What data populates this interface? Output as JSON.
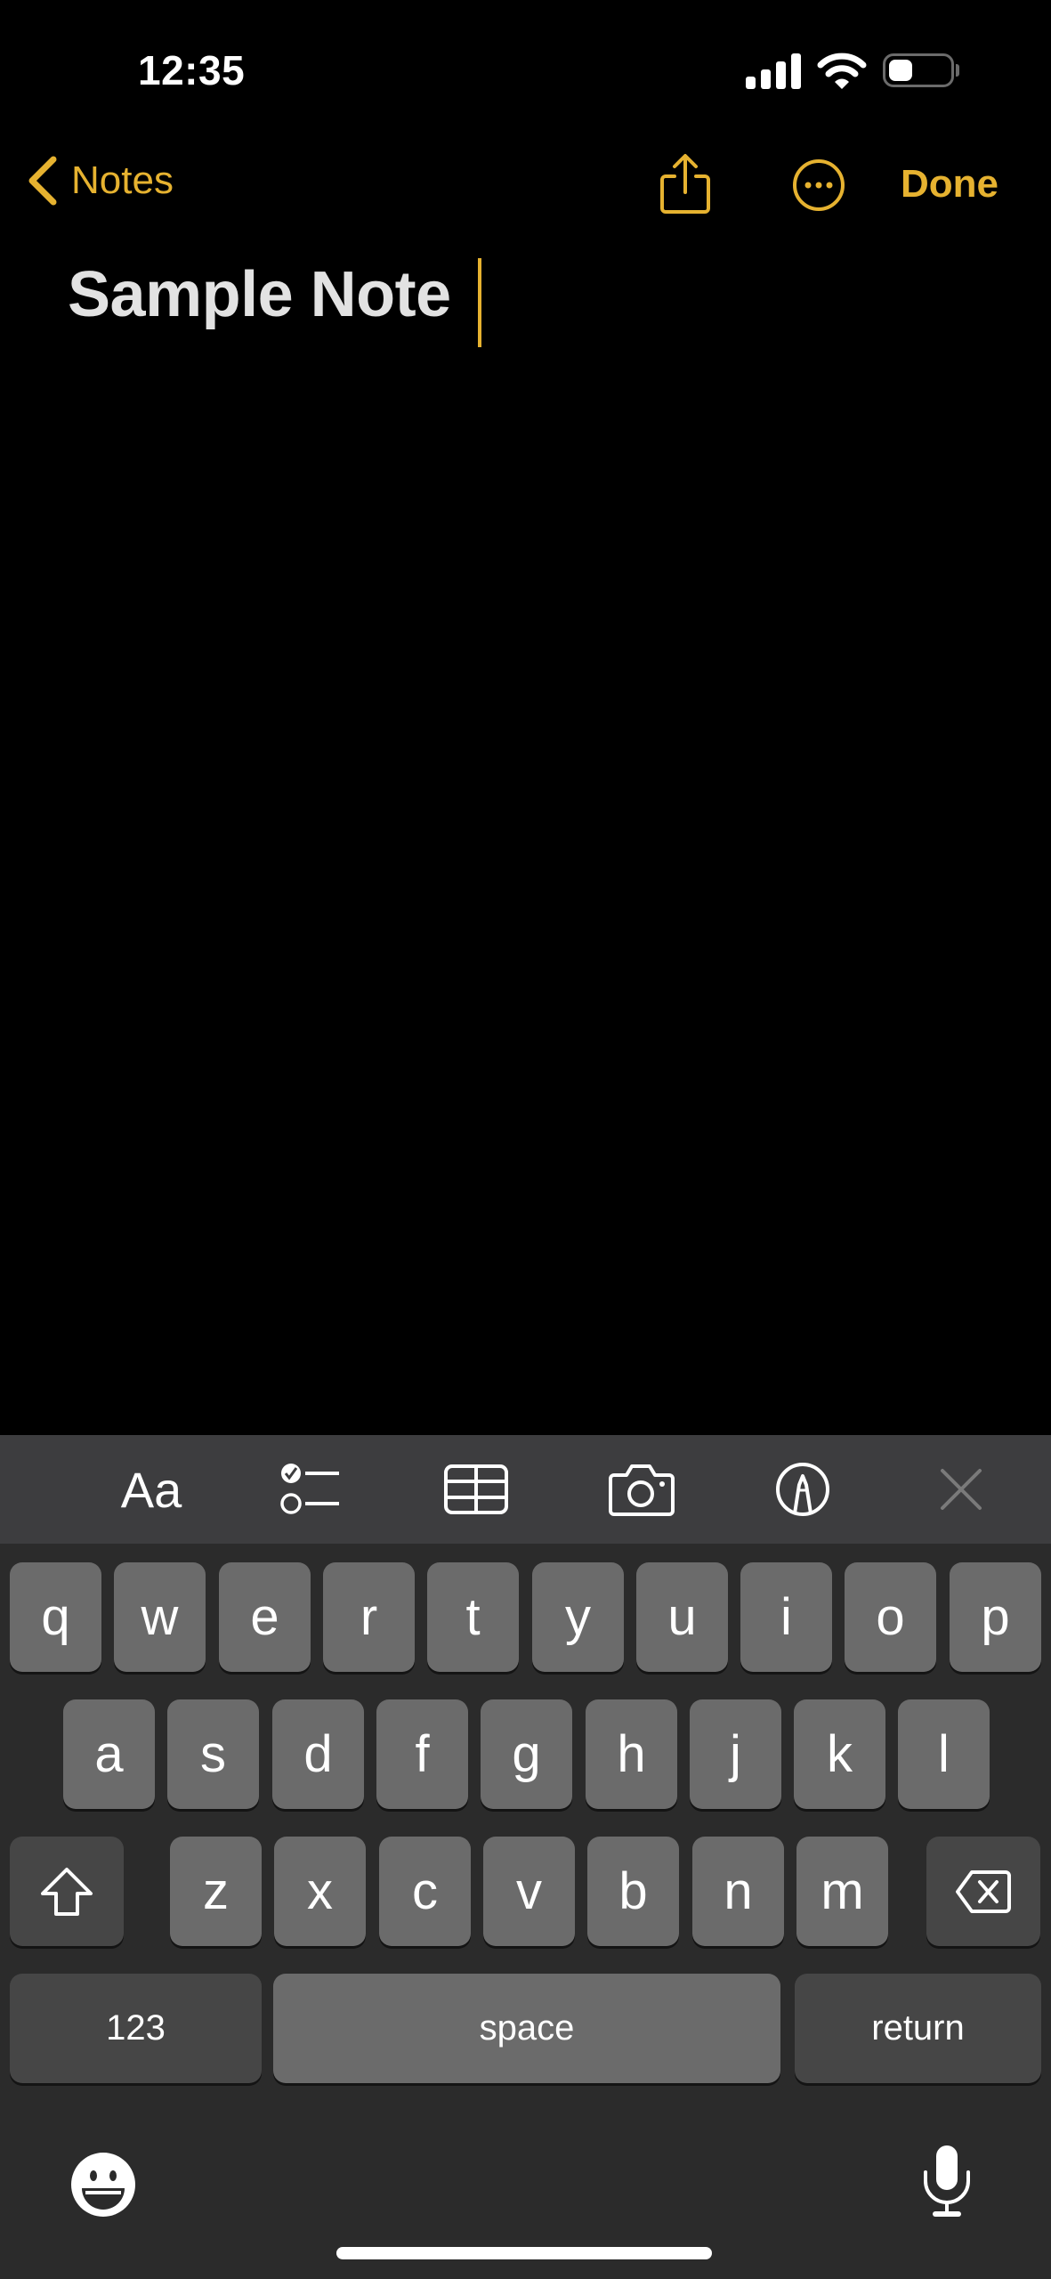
{
  "status_bar": {
    "time": "12:35",
    "signal_icon": "cellular-signal-icon",
    "wifi_icon": "wifi-icon",
    "battery_icon": "battery-icon",
    "battery_level_fraction": 0.4
  },
  "nav": {
    "back_label": "Notes",
    "back_icon": "chevron-left-icon",
    "share_icon": "share-icon",
    "more_icon": "ellipsis-circle-icon",
    "done_label": "Done"
  },
  "note": {
    "title": "Sample Note"
  },
  "toolbar": {
    "format_label": "Aa",
    "items": [
      {
        "name": "format-icon"
      },
      {
        "name": "checklist-icon"
      },
      {
        "name": "table-icon"
      },
      {
        "name": "camera-icon"
      },
      {
        "name": "markup-icon"
      },
      {
        "name": "close-icon"
      }
    ]
  },
  "keyboard": {
    "row1": [
      "q",
      "w",
      "e",
      "r",
      "t",
      "y",
      "u",
      "i",
      "o",
      "p"
    ],
    "row2": [
      "a",
      "s",
      "d",
      "f",
      "g",
      "h",
      "j",
      "k",
      "l"
    ],
    "row3": [
      "z",
      "x",
      "c",
      "v",
      "b",
      "n",
      "m"
    ],
    "numbers_label": "123",
    "space_label": "space",
    "return_label": "return",
    "shift_icon": "shift-icon",
    "delete_icon": "delete-backward-icon",
    "emoji_icon": "emoji-icon",
    "mic_icon": "microphone-icon"
  },
  "colors": {
    "accent": "#e6b230",
    "background": "#000000",
    "toolbar": "#3d3d3f",
    "keyboard": "#2b2b2b",
    "key": "#6b6b6b",
    "key_dark": "#464646"
  }
}
